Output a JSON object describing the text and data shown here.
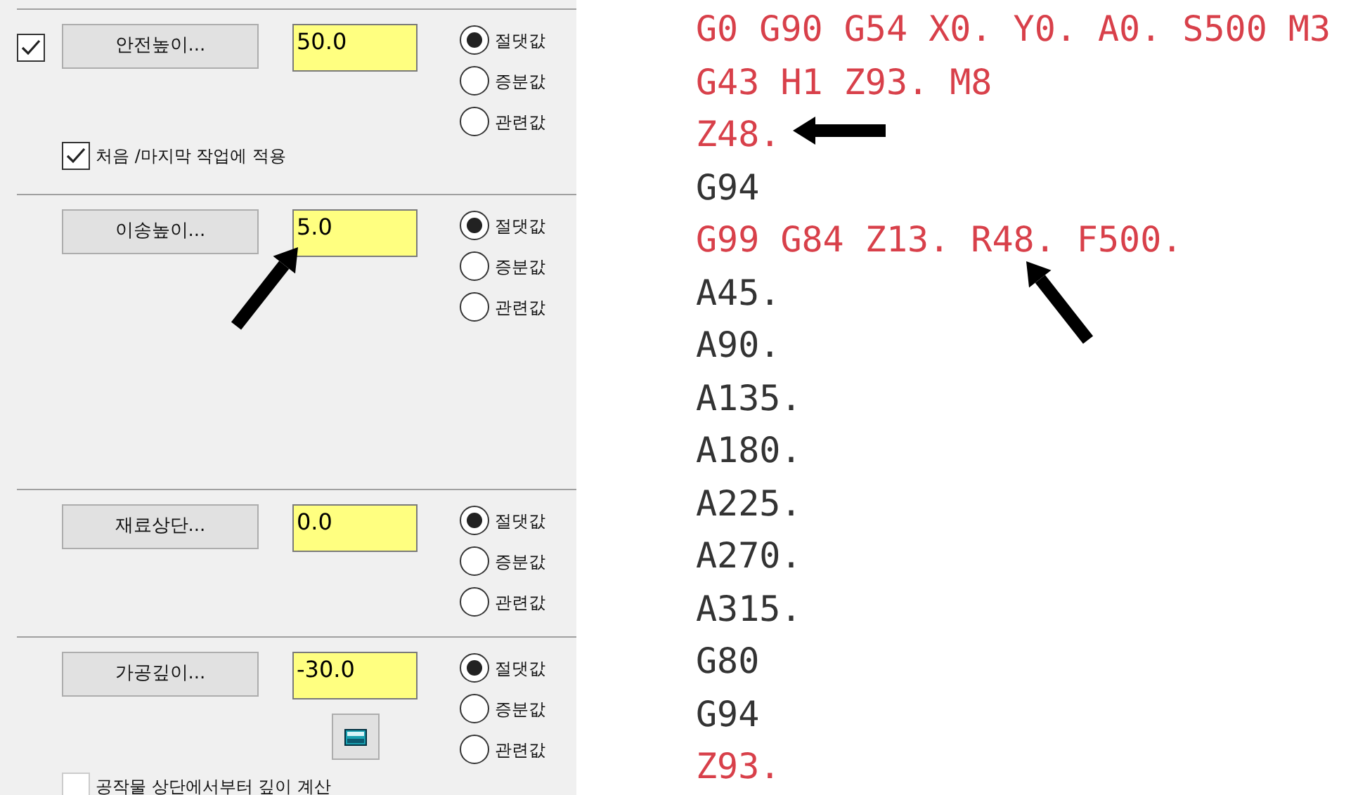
{
  "sections": [
    {
      "enable_checkbox": {
        "checked": true
      },
      "button": "안전높이...",
      "value": "50.0",
      "options": [
        {
          "label": "절댓값",
          "selected": true
        },
        {
          "label": "증분값",
          "selected": false
        },
        {
          "label": "관련값",
          "selected": false
        }
      ],
      "sub_checkbox": {
        "label": "처음 /마지막 작업에 적용",
        "checked": true
      }
    },
    {
      "button": "이송높이...",
      "value": "5.0",
      "options": [
        {
          "label": "절댓값",
          "selected": true
        },
        {
          "label": "증분값",
          "selected": false
        },
        {
          "label": "관련값",
          "selected": false
        }
      ]
    },
    {
      "button": "재료상단...",
      "value": "0.0",
      "options": [
        {
          "label": "절댓값",
          "selected": true
        },
        {
          "label": "증분값",
          "selected": false
        },
        {
          "label": "관련값",
          "selected": false
        }
      ]
    },
    {
      "button": "가공깊이...",
      "value": "-30.0",
      "calculator_button": true,
      "options": [
        {
          "label": "절댓값",
          "selected": true
        },
        {
          "label": "증분값",
          "selected": false
        },
        {
          "label": "관련값",
          "selected": false
        }
      ],
      "sub_checkbox": {
        "label": "공작물 상단에서부터 깊이 계산",
        "checked": false
      }
    }
  ],
  "code_lines": [
    {
      "text": "G0 G90 G54 X0. Y0. A0. S500 M3",
      "highlighted": true
    },
    {
      "text": "G43 H1 Z93. M8",
      "highlighted": true
    },
    {
      "text": "Z48.",
      "highlighted": true
    },
    {
      "text": "G94",
      "highlighted": false
    },
    {
      "text": "G99 G84 Z13. R48. F500.",
      "highlighted": true
    },
    {
      "text": "A45.",
      "highlighted": false
    },
    {
      "text": "A90.",
      "highlighted": false
    },
    {
      "text": "A135.",
      "highlighted": false
    },
    {
      "text": "A180.",
      "highlighted": false
    },
    {
      "text": "A225.",
      "highlighted": false
    },
    {
      "text": "A270.",
      "highlighted": false
    },
    {
      "text": "A315.",
      "highlighted": false
    },
    {
      "text": "G80",
      "highlighted": false
    },
    {
      "text": "G94",
      "highlighted": false
    },
    {
      "text": "Z93.",
      "highlighted": true
    }
  ]
}
